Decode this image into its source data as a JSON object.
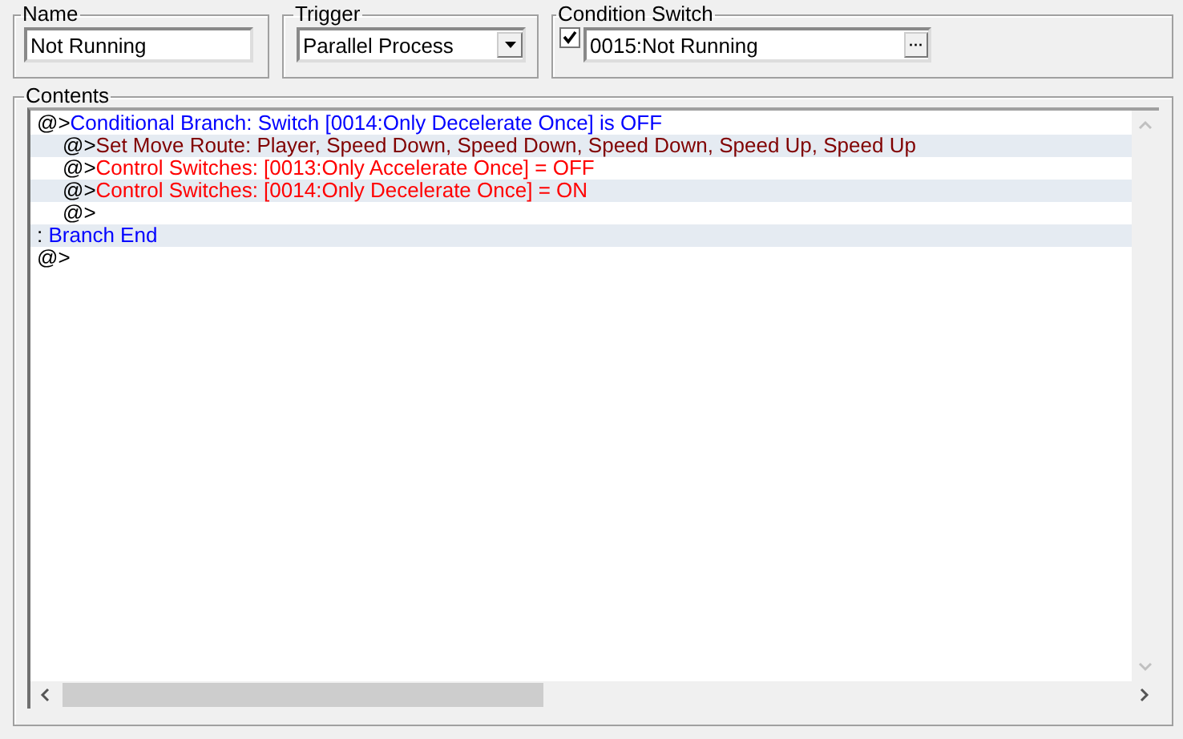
{
  "name_group": {
    "label": "Name",
    "value": "Not Running"
  },
  "trigger_group": {
    "label": "Trigger",
    "value": "Parallel Process"
  },
  "condition_group": {
    "label": "Condition Switch",
    "checked": true,
    "value": "0015:Not Running",
    "button": "···"
  },
  "contents": {
    "label": "Contents",
    "lines": [
      {
        "kind": "branch",
        "prefix": "@>",
        "text": "Conditional Branch: Switch [0014:Only Decelerate Once] is OFF",
        "children": [
          {
            "kind": "move_route",
            "prefix": "@>",
            "text": "Set Move Route: Player, Speed Down, Speed Down, Speed Down, Speed Up, Speed Up"
          },
          {
            "kind": "control",
            "prefix": "@>",
            "text": "Control Switches: [0013:Only Accelerate Once] = OFF"
          },
          {
            "kind": "control",
            "prefix": "@>",
            "text": "Control Switches: [0014:Only Decelerate Once] = ON"
          },
          {
            "prefix": "@>"
          }
        ]
      },
      {
        "kind": "branch_end",
        "prefix": ":",
        "text": "Branch End"
      },
      {
        "prefix": "@>"
      }
    ]
  }
}
